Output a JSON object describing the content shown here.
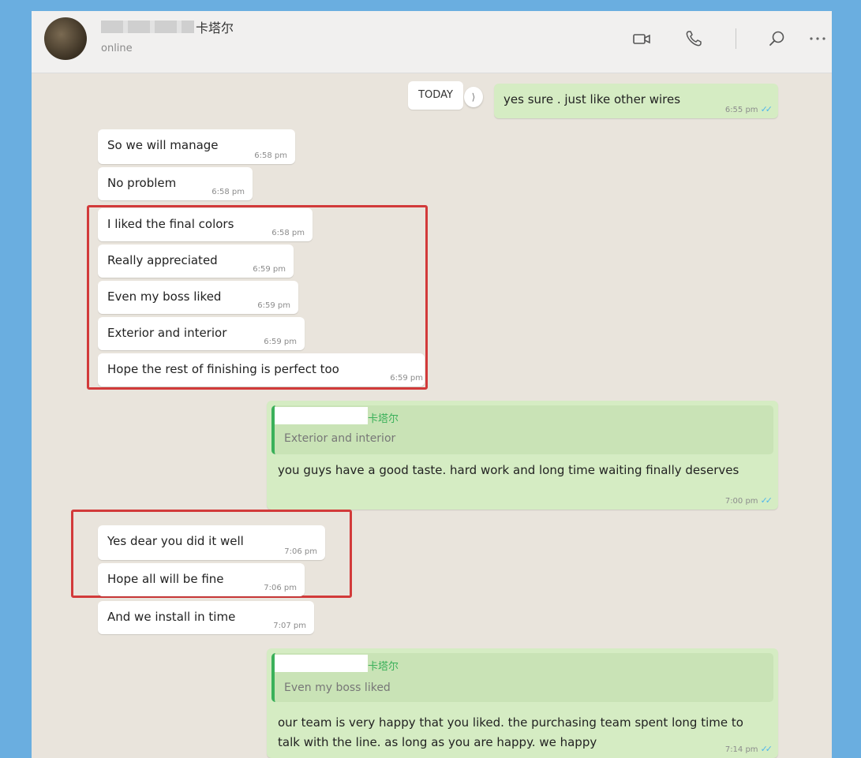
{
  "header": {
    "contact_name": "卡塔尔",
    "status": "online"
  },
  "date_divider": "TODAY",
  "messages": {
    "m0": {
      "text": "yes sure . just like other wires",
      "time": "6:55 pm"
    },
    "m1": {
      "text": "So we will manage",
      "time": "6:58 pm"
    },
    "m2": {
      "text": "No problem",
      "time": "6:58 pm"
    },
    "m3": {
      "text": "I liked the final colors",
      "time": "6:58 pm"
    },
    "m4": {
      "text": "Really appreciated",
      "time": "6:59 pm"
    },
    "m5": {
      "text": "Even my boss liked",
      "time": "6:59 pm"
    },
    "m6": {
      "text": "Exterior and interior",
      "time": "6:59 pm"
    },
    "m7": {
      "text": "Hope the rest of finishing is perfect too",
      "time": "6:59 pm"
    },
    "m8": {
      "quote_name": "卡塔尔",
      "quote_text": "Exterior and interior",
      "text": "you guys have a good taste. hard work and long time waiting finally deserves",
      "time": "7:00 pm"
    },
    "m9": {
      "text": "Yes dear you did it well",
      "time": "7:06 pm"
    },
    "m10": {
      "text": "Hope all will be fine",
      "time": "7:06 pm"
    },
    "m11": {
      "text": "And we install in time",
      "time": "7:07 pm"
    },
    "m12": {
      "quote_name": "卡塔尔",
      "quote_text": "Even my boss liked",
      "text": "our team is very happy that you liked. the purchasing team spent long time to talk with the line. as long as you are happy. we happy",
      "time": "7:14 pm"
    }
  },
  "icons": {
    "video": "video-call-icon",
    "voice": "voice-call-icon",
    "search": "search-icon",
    "menu": "more-options-icon"
  },
  "colors": {
    "incoming_bubble": "#ffffff",
    "outgoing_bubble": "#d5ecc3",
    "highlight": "#d23a3a",
    "read_ticks": "#4fb6ec",
    "quote_accent": "#3bb05a"
  }
}
